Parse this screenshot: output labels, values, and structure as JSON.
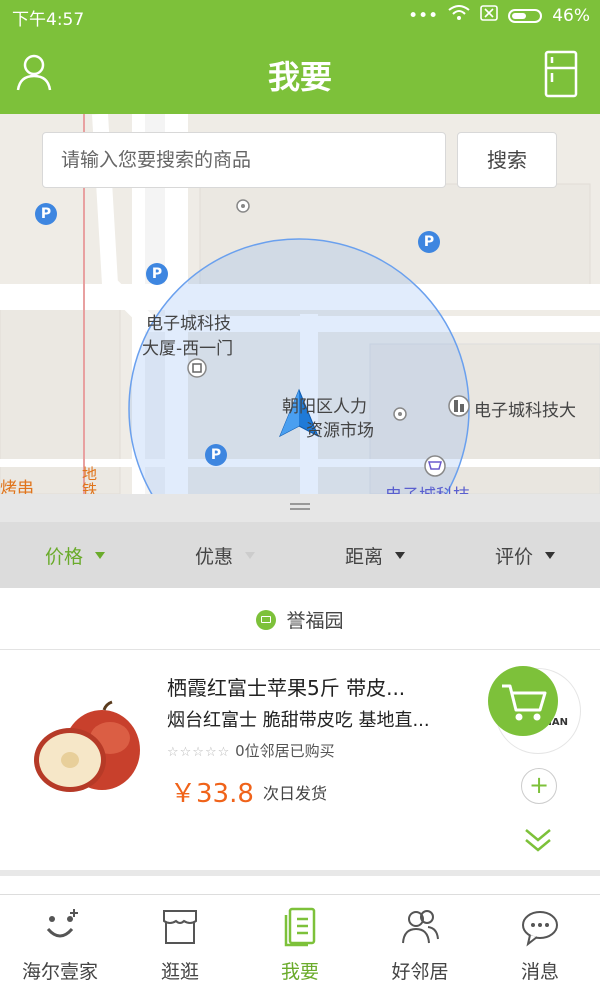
{
  "status_bar": {
    "time": "下午4:57",
    "battery": "46%"
  },
  "header": {
    "title": "我要"
  },
  "search": {
    "placeholder": "请输入您要搜索的商品",
    "button": "搜索"
  },
  "map": {
    "poi": {
      "gate_line1": "电子城科技",
      "gate_line2": "大厦-西一门",
      "market_line1": "朝阳区人力",
      "market_line2": "资源市场",
      "tower": "电子城科技大",
      "bottom": "电子城科技",
      "bbq": "烤串",
      "subway": "地铁"
    },
    "parking_label": "P"
  },
  "filters": [
    {
      "label": "价格",
      "active": true
    },
    {
      "label": "优惠",
      "active": false
    },
    {
      "label": "距离",
      "active": false
    },
    {
      "label": "评价",
      "active": false
    }
  ],
  "store": {
    "name": "誉福园"
  },
  "product": {
    "title": "栖霞红富士苹果5斤 带皮...",
    "subtitle": "烟台红富士 脆甜带皮吃 基地直...",
    "stars": "☆☆☆☆☆",
    "purchases": "0位邻居已购买",
    "price": "￥33.8",
    "shipping": "次日发货",
    "brand_text": "JIAN"
  },
  "nav": [
    {
      "label": "海尔壹家",
      "icon": "smile-icon",
      "active": false
    },
    {
      "label": "逛逛",
      "icon": "shop-icon",
      "active": false
    },
    {
      "label": "我要",
      "icon": "list-icon",
      "active": true
    },
    {
      "label": "好邻居",
      "icon": "people-icon",
      "active": false
    },
    {
      "label": "消息",
      "icon": "chat-icon",
      "active": false
    }
  ],
  "colors": {
    "brand_green": "#7dc13a",
    "price_orange": "#f0631a",
    "map_blue": "#3e86e0"
  }
}
